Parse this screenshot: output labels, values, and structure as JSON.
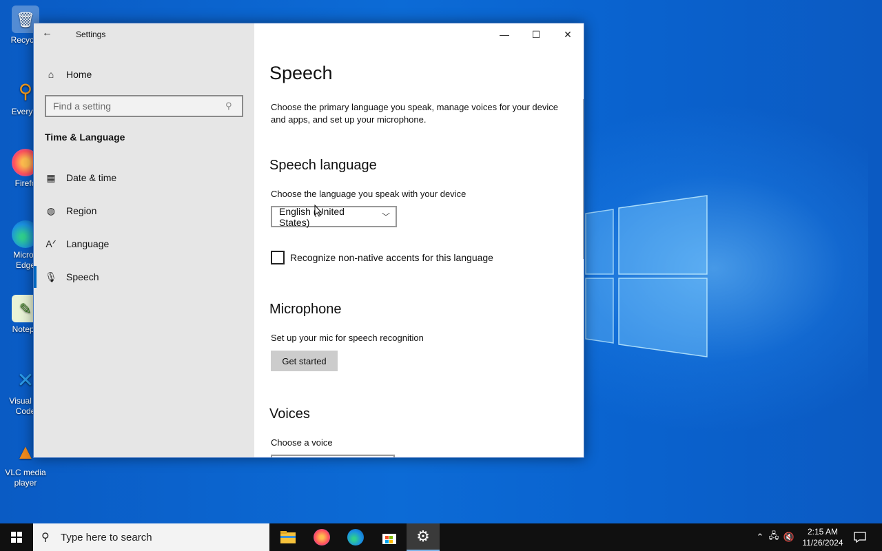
{
  "desktop": {
    "icons": [
      {
        "label": "Recycle",
        "icon": "recycle-bin-icon"
      },
      {
        "label": "Everyth",
        "icon": "everything-search-icon"
      },
      {
        "label": "Firefo",
        "icon": "firefox-icon"
      },
      {
        "label": "Micros\nEdge",
        "label_line1": "Micros",
        "label_line2": "Edge",
        "icon": "edge-icon"
      },
      {
        "label": "Notepa",
        "icon": "notepad-icon"
      },
      {
        "label_line1": "Visual St",
        "label_line2": "Code",
        "icon": "vscode-icon"
      },
      {
        "label_line1": "VLC media",
        "label_line2": "player",
        "icon": "vlc-icon"
      }
    ]
  },
  "window": {
    "title": "Settings",
    "controls": {
      "minimize": "—",
      "maximize": "☐",
      "close": "✕"
    },
    "sidebar": {
      "home_label": "Home",
      "search_placeholder": "Find a setting",
      "section_title": "Time & Language",
      "items": [
        {
          "label": "Date & time",
          "icon": "calendar-clock-icon"
        },
        {
          "label": "Region",
          "icon": "globe-icon"
        },
        {
          "label": "Language",
          "icon": "language-icon"
        },
        {
          "label": "Speech",
          "icon": "microphone-icon",
          "selected": true
        }
      ]
    },
    "main": {
      "title": "Speech",
      "intro": "Choose the primary language you speak, manage voices for your device and apps, and set up your microphone.",
      "speech_language": {
        "heading": "Speech language",
        "label": "Choose the language you speak with your device",
        "selected_value": "English (United States)",
        "checkbox_label": "Recognize non-native accents for this language",
        "checkbox_checked": false
      },
      "microphone": {
        "heading": "Microphone",
        "label": "Set up your mic for speech recognition",
        "button_label": "Get started"
      },
      "voices": {
        "heading": "Voices",
        "label": "Choose a voice"
      }
    }
  },
  "taskbar": {
    "search_placeholder": "Type here to search",
    "apps": [
      "file-explorer-icon",
      "firefox-icon",
      "edge-icon",
      "store-icon",
      "settings-icon"
    ],
    "active_app": "settings-icon",
    "clock_time": "2:15 AM",
    "clock_date": "11/26/2024"
  },
  "colors": {
    "accent": "#0067c0",
    "sidebar_bg": "#e6e6e6",
    "taskbar_bg": "#101010"
  }
}
